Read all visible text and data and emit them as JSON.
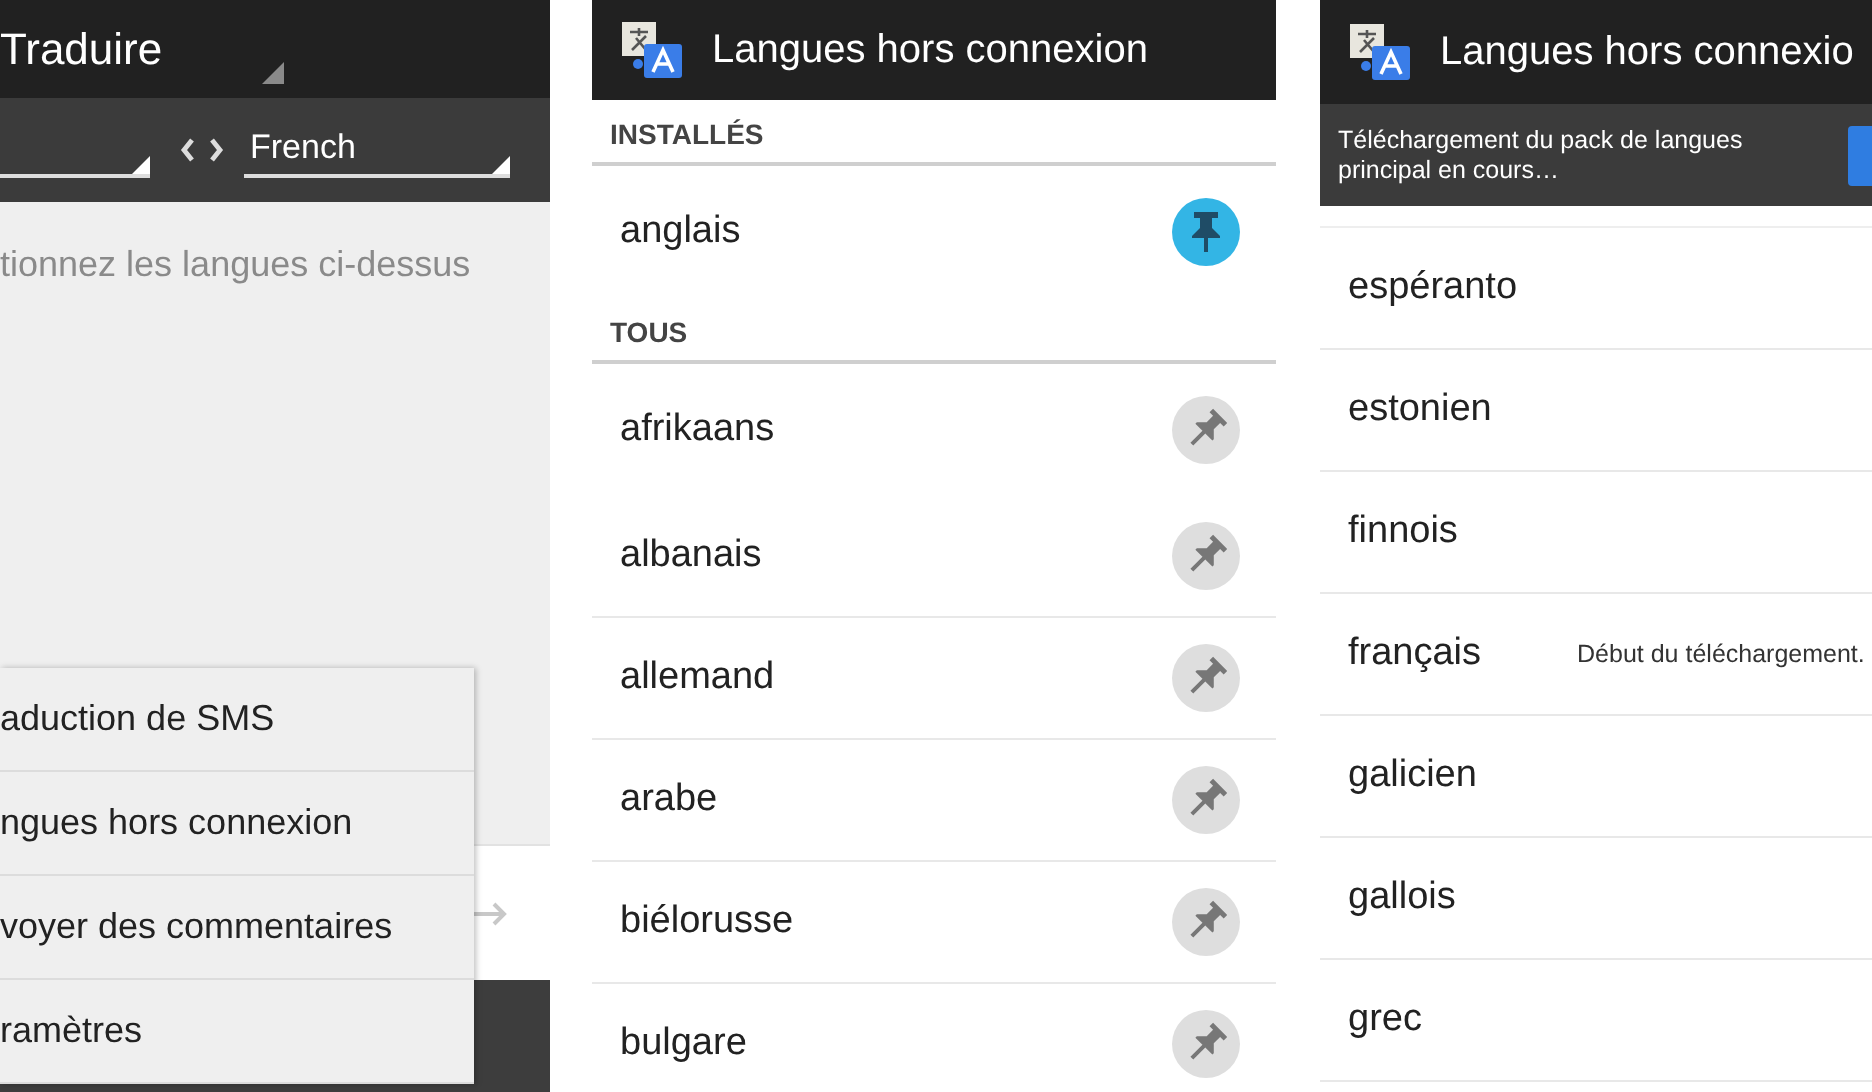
{
  "translate_screen": {
    "title": "Traduire",
    "target_language": "French",
    "placeholder": "tionnez les langues ci-dessus",
    "menu": [
      {
        "label": "aduction de SMS"
      },
      {
        "label": "ngues hors connexion"
      },
      {
        "label": "voyer des commentaires"
      },
      {
        "label": "ramètres"
      }
    ]
  },
  "offline_screen": {
    "title": "Langues hors connexion",
    "sections": [
      {
        "heading": "INSTALLÉS",
        "items": [
          {
            "name": "anglais",
            "installed": true
          }
        ]
      },
      {
        "heading": "TOUS",
        "items": [
          {
            "name": "afrikaans",
            "installed": false
          },
          {
            "name": "albanais",
            "installed": false
          },
          {
            "name": "allemand",
            "installed": false
          },
          {
            "name": "arabe",
            "installed": false
          },
          {
            "name": "biélorusse",
            "installed": false
          },
          {
            "name": "bulgare",
            "installed": false
          }
        ]
      }
    ]
  },
  "download_screen": {
    "title": "Langues hors connexio",
    "banner": "Téléchargement du pack de langues principal en cours…",
    "items": [
      {
        "name": "espéranto"
      },
      {
        "name": "estonien"
      },
      {
        "name": "finnois"
      },
      {
        "name": "français",
        "status": "Début du téléchargement."
      },
      {
        "name": "galicien"
      },
      {
        "name": "gallois"
      },
      {
        "name": "grec"
      }
    ]
  }
}
